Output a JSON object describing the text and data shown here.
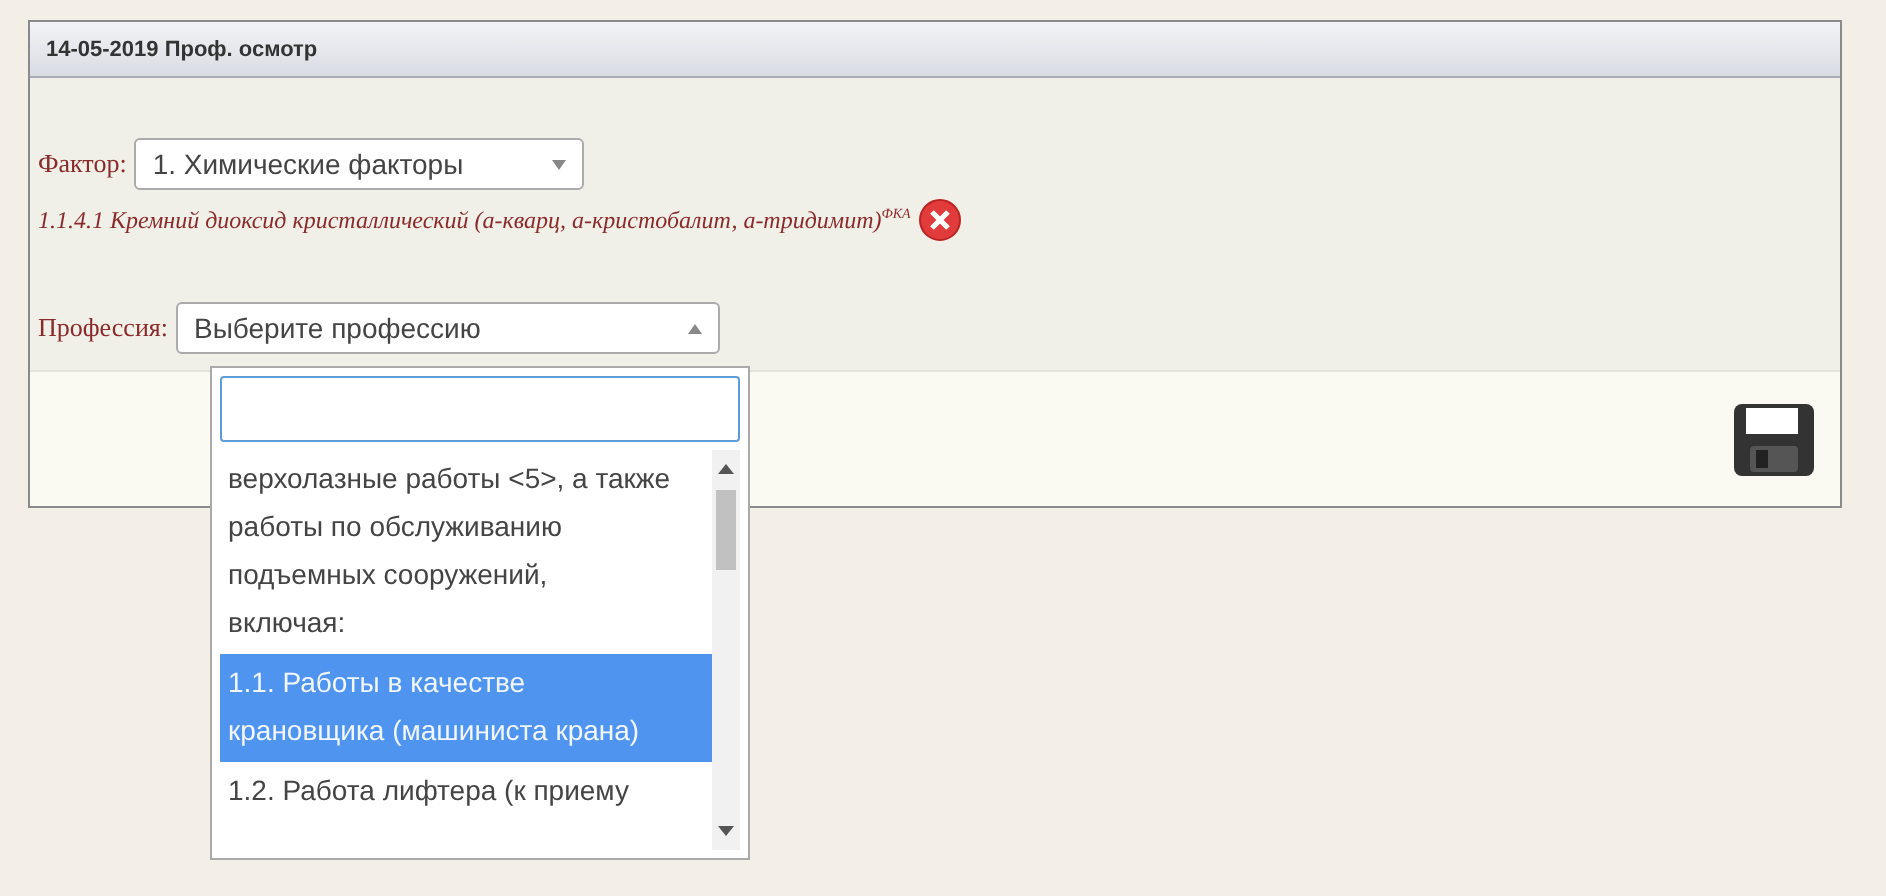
{
  "panel": {
    "title": "14-05-2019 Проф. осмотр"
  },
  "factor": {
    "label": "Фактор:",
    "value": "1. Химические факторы"
  },
  "selected_factor": {
    "text": "1.1.4.1 Кремний диоксид кристаллический (а-кварц, а-кристобалит, а-тридимит)$^{ФКА}$"
  },
  "profession": {
    "label": "Профессия:",
    "placeholder": "Выберите профессию",
    "expanded": true
  },
  "dropdown": {
    "options": [
      {
        "text": "верхолазные работы <5>, а также работы по обслуживанию подъемных сооружений, включая:",
        "selected": false
      },
      {
        "text": "1.1. Работы в качестве крановщика (машиниста крана)",
        "selected": true
      },
      {
        "text": "1.2. Работа лифтера (к приему",
        "selected": false
      }
    ]
  }
}
